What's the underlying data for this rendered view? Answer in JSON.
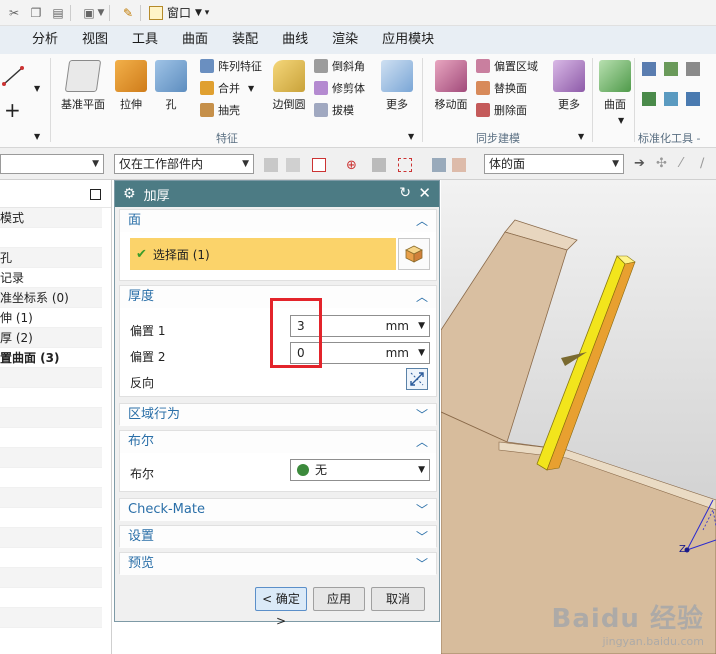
{
  "qat": {
    "window_label": "窗口",
    "icons": [
      "cut-icon",
      "copy-icon",
      "paste-icon",
      "window-icon",
      "window-dropdown-icon",
      "customize-icon"
    ]
  },
  "tabs": [
    "分析",
    "视图",
    "工具",
    "曲面",
    "装配",
    "曲线",
    "渲染",
    "应用模块"
  ],
  "ribbon": {
    "feature_group_label": "特征",
    "sync_group_label": "同步建模",
    "std_group_label": "标准化工具 - G...",
    "buttons": {
      "datum_plane": "基准平面",
      "extrude": "拉伸",
      "hole": "孔",
      "pattern_feature": "阵列特征",
      "unite": "合并",
      "shell": "抽壳",
      "edge_blend": "边倒圆",
      "chamfer": "倒斜角",
      "trim_body": "修剪体",
      "draft": "拔模",
      "more1": "更多",
      "move_face": "移动面",
      "offset_region": "偏置区域",
      "replace_face": "替换面",
      "delete_face": "删除面",
      "more2": "更多",
      "surface": "曲面"
    }
  },
  "selbar": {
    "filter1": "",
    "filter2": "仅在工作部件内",
    "filter3": "体的面"
  },
  "navigator": {
    "rows": [
      "模式",
      "",
      "孔",
      "记录",
      "准坐标系 (0)",
      "伸 (1)",
      "厚 (2)",
      "置曲面 (3)",
      "",
      "",
      "",
      "",
      "",
      "",
      "",
      "",
      "",
      "",
      "",
      "",
      ""
    ]
  },
  "dialog": {
    "title": "加厚",
    "face_section": "面",
    "select_face": "选择面 (1)",
    "thickness_section": "厚度",
    "offset1_label": "偏置 1",
    "offset1_value": "3",
    "offset1_unit": "mm",
    "offset2_label": "偏置 2",
    "offset2_value": "0",
    "offset2_unit": "mm",
    "reverse_label": "反向",
    "region_section": "区域行为",
    "boolean_section": "布尔",
    "boolean_label": "布尔",
    "boolean_value": "无",
    "checkmate_section": "Check-Mate",
    "settings_section": "设置",
    "preview_section": "预览",
    "ok": "< 确定 >",
    "apply": "应用",
    "cancel": "取消"
  },
  "viewport": {
    "wm_brand": "Baidu 经验",
    "wm_url": "jingyan.baidu.com",
    "axis_label": "Z"
  },
  "colors": {
    "dialog_title_bg": "#4c7b84",
    "section_header": "#2a6fa8",
    "selected_row": "#fbd36a",
    "highlight_box": "#e3242b",
    "part_body": "#dcc3a5",
    "selected_face": "#f2e51c"
  }
}
